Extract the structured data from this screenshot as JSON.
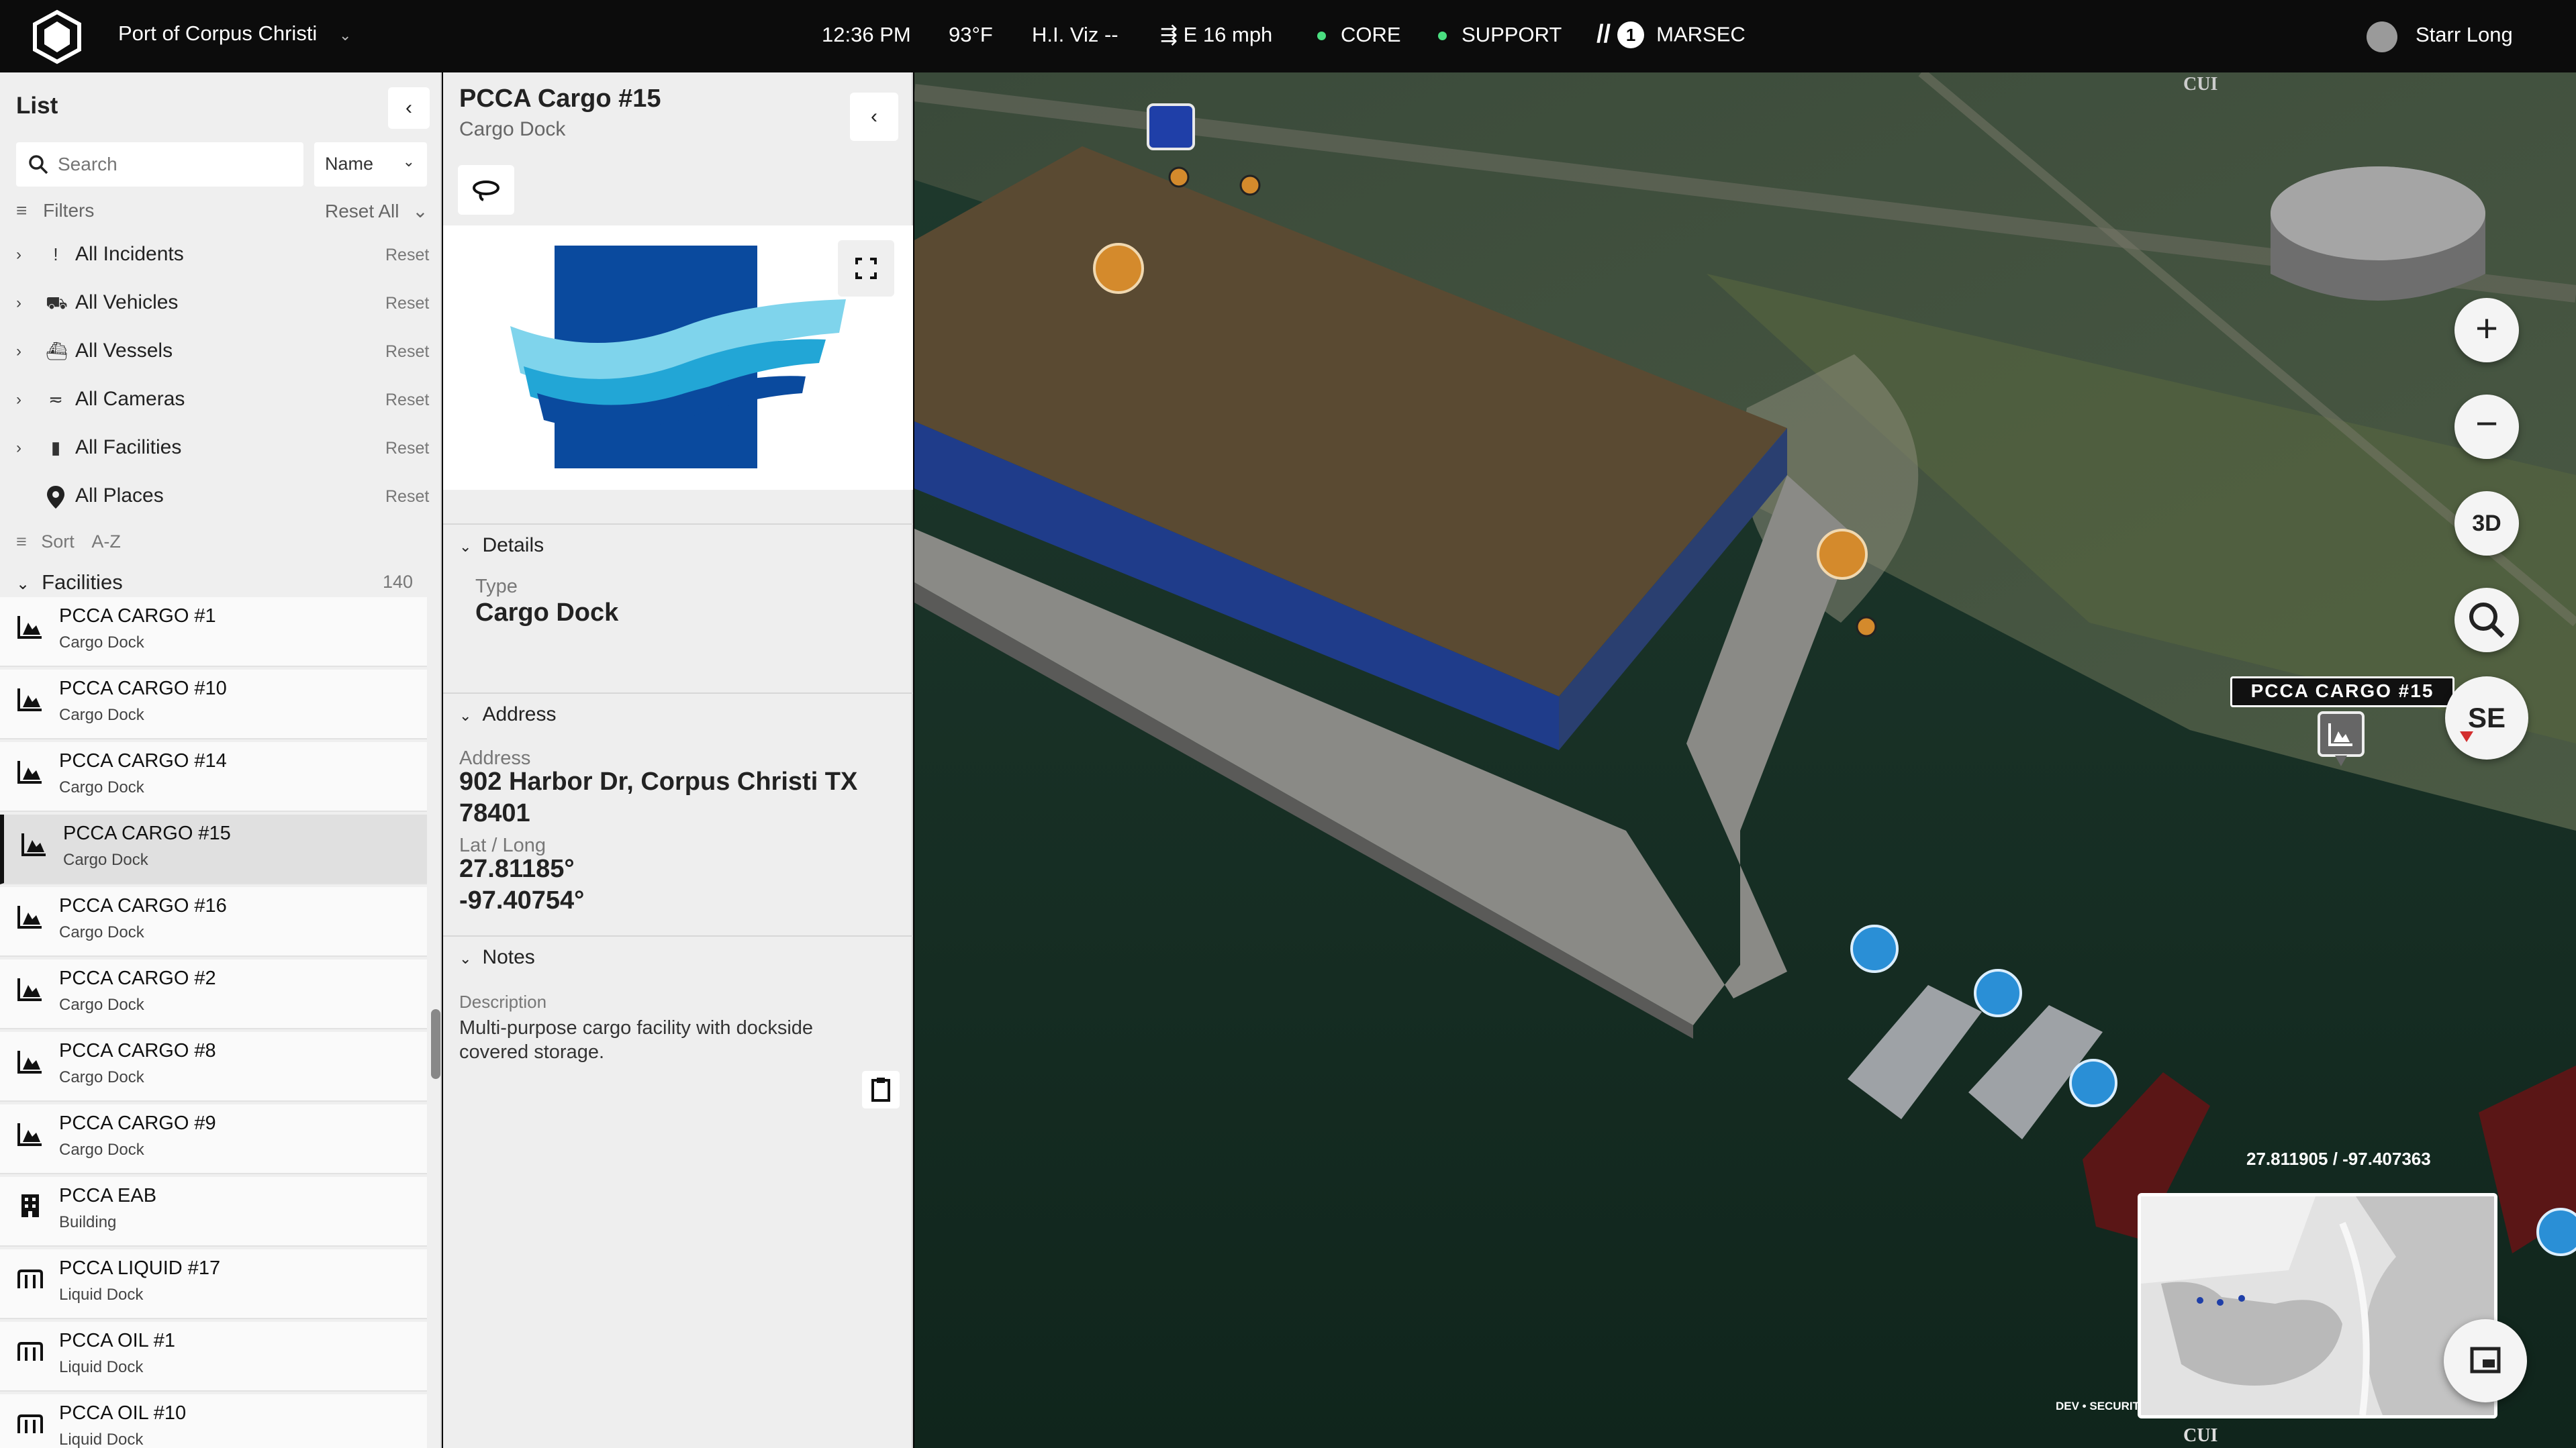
{
  "header": {
    "site_name": "Port of Corpus Christi",
    "time": "12:36 PM",
    "temperature": "93°F",
    "visibility": "H.I. Viz --",
    "wind": "E 16 mph",
    "status_core": "CORE",
    "status_support": "SUPPORT",
    "marsec_level": "1",
    "marsec_label": "MARSEC",
    "user_name": "Starr Long"
  },
  "list": {
    "title": "List",
    "search_placeholder": "Search",
    "sort_field": "Name",
    "filters_label": "Filters",
    "reset_all": "Reset All",
    "filters": [
      {
        "label": "All Incidents",
        "reset": "Reset"
      },
      {
        "label": "All Vehicles",
        "reset": "Reset"
      },
      {
        "label": "All Vessels",
        "reset": "Reset"
      },
      {
        "label": "All Cameras",
        "reset": "Reset"
      },
      {
        "label": "All Facilities",
        "reset": "Reset"
      },
      {
        "label": "All Places",
        "reset": "Reset"
      }
    ],
    "sort_label": "Sort",
    "sort_value": "A-Z",
    "facilities_label": "Facilities",
    "facilities_count": "140",
    "items": [
      {
        "name": "PCCA CARGO #1",
        "type": "Cargo Dock"
      },
      {
        "name": "PCCA CARGO #10",
        "type": "Cargo Dock"
      },
      {
        "name": "PCCA CARGO #14",
        "type": "Cargo Dock"
      },
      {
        "name": "PCCA CARGO #15",
        "type": "Cargo Dock"
      },
      {
        "name": "PCCA CARGO #16",
        "type": "Cargo Dock"
      },
      {
        "name": "PCCA CARGO #2",
        "type": "Cargo Dock"
      },
      {
        "name": "PCCA CARGO #8",
        "type": "Cargo Dock"
      },
      {
        "name": "PCCA CARGO #9",
        "type": "Cargo Dock"
      },
      {
        "name": "PCCA EAB",
        "type": "Building"
      },
      {
        "name": "PCCA LIQUID #17",
        "type": "Liquid Dock"
      },
      {
        "name": "PCCA OIL #1",
        "type": "Liquid Dock"
      },
      {
        "name": "PCCA OIL #10",
        "type": "Liquid Dock"
      }
    ]
  },
  "detail": {
    "title": "PCCA Cargo #15",
    "subtitle": "Cargo Dock",
    "details_header": "Details",
    "type_label": "Type",
    "type_value": "Cargo Dock",
    "address_header": "Address",
    "address_label": "Address",
    "address_line1": "902 Harbor Dr, Corpus Christi TX",
    "address_line2": "78401",
    "latlong_label": "Lat / Long",
    "lat": "27.81185°",
    "long": "-97.40754°",
    "notes_header": "Notes",
    "description_label": "Description",
    "description_line1": "Multi-purpose cargo facility with dockside",
    "description_line2": "covered storage."
  },
  "map": {
    "cui_top": "CUI",
    "cui_bottom": "CUI",
    "dev_banner": "DEV • SECURITY DATA IS SYNTHETIC FOR TESTING",
    "callout": "PCCA CARGO #15",
    "compass": "SE",
    "view_mode": "3D",
    "coordinates": "27.811905 / -97.407363",
    "zoom_in": "+",
    "zoom_out": "−"
  },
  "colors": {
    "accent_green": "#4ade80",
    "vessel_marker": "#2a8fd6",
    "vehicle_marker": "#d48a2c",
    "logo_blue": "#0a4a9e",
    "logo_cyan": "#4cc3e0"
  }
}
